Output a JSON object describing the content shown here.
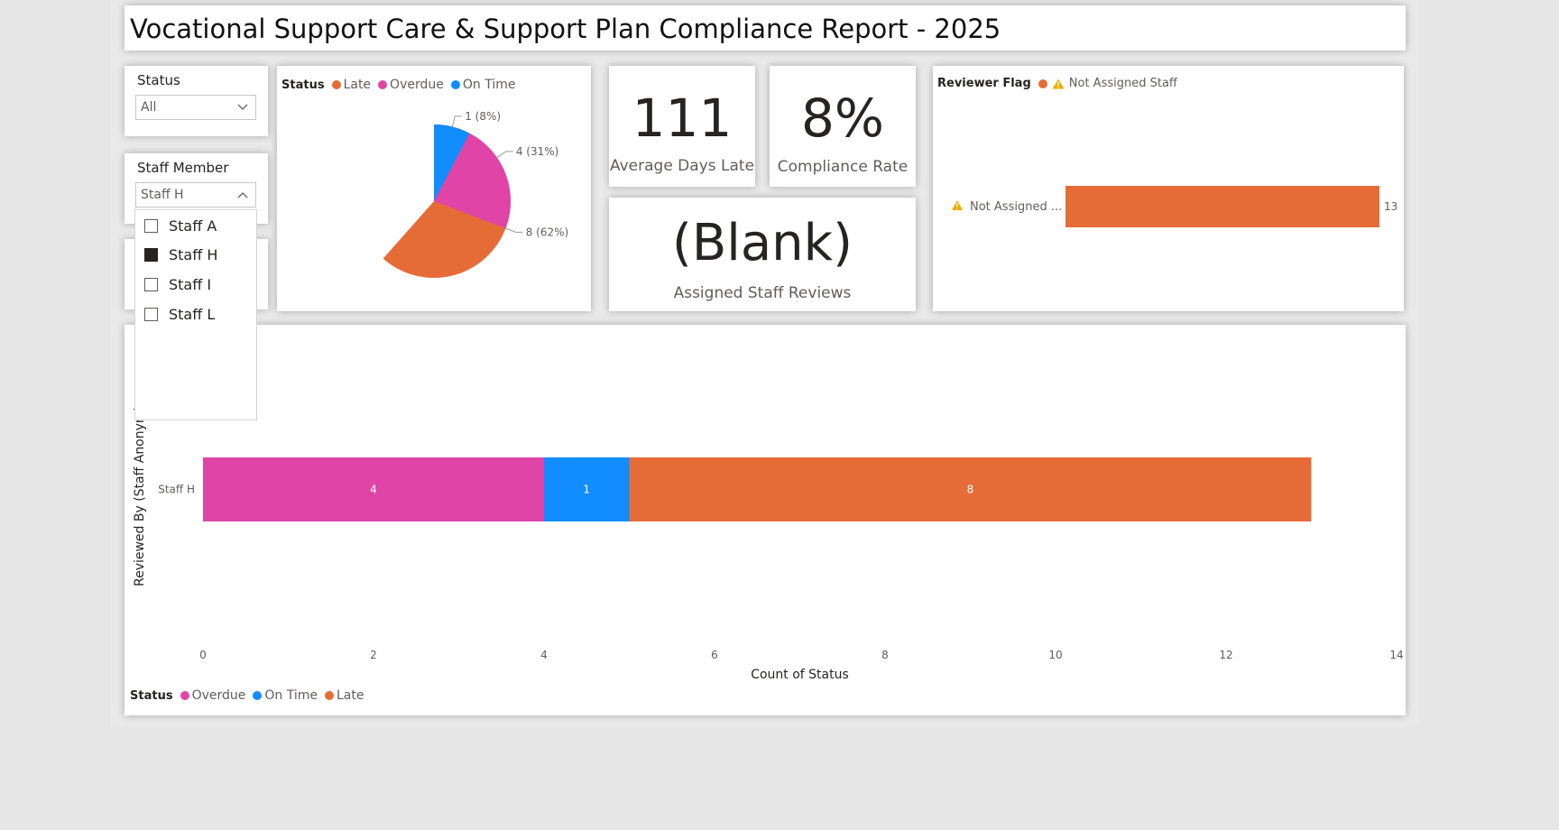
{
  "report_title": "Vocational Support Care & Support Plan Compliance Report - 2025",
  "status_slicer": {
    "label": "Status",
    "value": "All"
  },
  "staff_slicer": {
    "label": "Staff Member",
    "value": "Staff H",
    "options": [
      {
        "label": "Staff A",
        "checked": false
      },
      {
        "label": "Staff H",
        "checked": true
      },
      {
        "label": "Staff I",
        "checked": false
      },
      {
        "label": "Staff L",
        "checked": false
      }
    ]
  },
  "colors": {
    "late": "#e66c37",
    "overdue": "#e044a7",
    "on_time": "#118dff"
  },
  "kpis": {
    "avg_days_late": {
      "value": "111",
      "label": "Average Days Late"
    },
    "compliance_rate": {
      "value": "8%",
      "label": "Compliance Rate"
    },
    "assigned_reviews": {
      "value": "(Blank)",
      "label": "Assigned Staff Reviews"
    }
  },
  "pie_legend": {
    "title": "Status",
    "items": [
      "Late",
      "Overdue",
      "On Time"
    ]
  },
  "flag_legend": {
    "title": "Reviewer Flag",
    "items": [
      "Not Assigned Staff"
    ]
  },
  "bar_legend": {
    "title": "Status",
    "items": [
      "Overdue",
      "On Time",
      "Late"
    ]
  },
  "chart_data": [
    {
      "type": "pie",
      "legend_title": "Status",
      "slices": [
        {
          "name": "Late",
          "value": 8,
          "label": "8 (62%)"
        },
        {
          "name": "Overdue",
          "value": 4,
          "label": "4 (31%)"
        },
        {
          "name": "On Time",
          "value": 1,
          "label": "1 (8%)"
        }
      ]
    },
    {
      "type": "bar",
      "orientation": "horizontal",
      "legend_title": "Reviewer Flag",
      "categories": [
        "Not Assigned ..."
      ],
      "series": [
        {
          "name": "Not Assigned Staff",
          "values": [
            13
          ]
        }
      ]
    },
    {
      "type": "bar",
      "orientation": "horizontal-stacked",
      "xlabel": "Count of Status",
      "ylabel": "Reviewed By (Staff Anonym)",
      "categories": [
        "Staff H"
      ],
      "xlim": [
        0,
        14
      ],
      "xticks": [
        "0",
        "2",
        "4",
        "6",
        "8",
        "10",
        "12",
        "14"
      ],
      "legend_title": "Status",
      "series": [
        {
          "name": "Overdue",
          "values": [
            4
          ]
        },
        {
          "name": "On Time",
          "values": [
            1
          ]
        },
        {
          "name": "Late",
          "values": [
            8
          ]
        }
      ]
    }
  ]
}
